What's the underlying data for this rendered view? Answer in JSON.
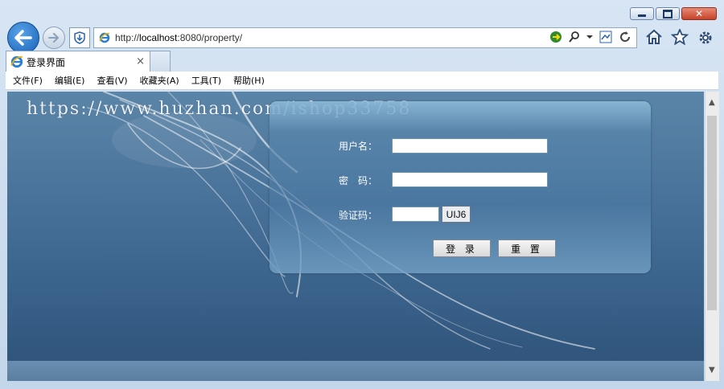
{
  "browser": {
    "url_prefix": "http://",
    "url_host": "localhost",
    "url_rest": ":8080/property/",
    "tab_title": "登录界面",
    "tab_close": "×",
    "menu": [
      "文件(F)",
      "编辑(E)",
      "查看(V)",
      "收藏夹(A)",
      "工具(T)",
      "帮助(H)"
    ]
  },
  "page": {
    "watermark": "https://www.huzhan.com/ishop33758",
    "login": {
      "username_label": "用户名：",
      "username_value": "",
      "password_label": "密　码：",
      "password_value": "",
      "captcha_label": "验证码：",
      "captcha_value": "",
      "captcha_code": "UIJ6",
      "login_button": "登 录",
      "reset_button": "重 置"
    }
  },
  "colors": {
    "accent": "#1760b8",
    "page_bg_top": "#5b85a8",
    "page_bg_bottom": "#2e5179"
  }
}
